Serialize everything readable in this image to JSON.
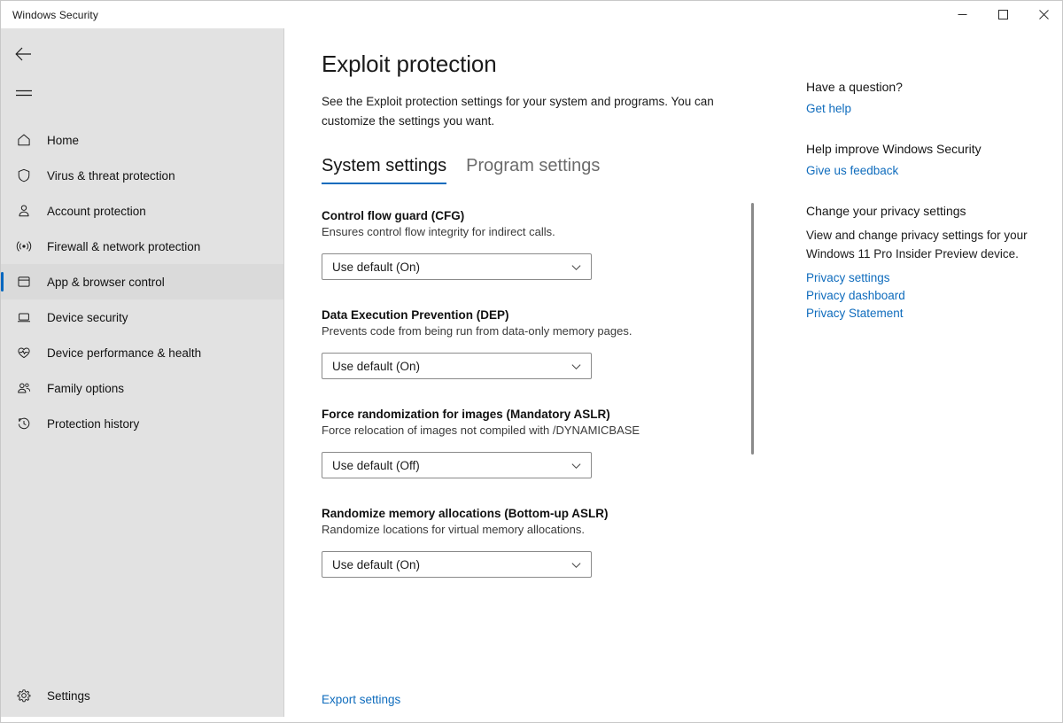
{
  "window": {
    "title": "Windows Security",
    "controls": [
      {
        "name": "minimize",
        "glyph": "minimize-icon"
      },
      {
        "name": "maximize",
        "glyph": "maximize-icon"
      },
      {
        "name": "close",
        "glyph": "close-icon"
      }
    ]
  },
  "sidebar": {
    "back_label": "Back",
    "menu_label": "Menu",
    "items": [
      {
        "label": "Home",
        "icon": "home-icon",
        "selected": false
      },
      {
        "label": "Virus & threat protection",
        "icon": "shield-icon",
        "selected": false
      },
      {
        "label": "Account protection",
        "icon": "person-icon",
        "selected": false
      },
      {
        "label": "Firewall & network protection",
        "icon": "broadcast-icon",
        "selected": false
      },
      {
        "label": "App & browser control",
        "icon": "app-window-icon",
        "selected": true
      },
      {
        "label": "Device security",
        "icon": "laptop-icon",
        "selected": false
      },
      {
        "label": "Device performance & health",
        "icon": "heart-pulse-icon",
        "selected": false
      },
      {
        "label": "Family options",
        "icon": "people-icon",
        "selected": false
      },
      {
        "label": "Protection history",
        "icon": "history-clock-icon",
        "selected": false
      }
    ],
    "settings": {
      "label": "Settings",
      "icon": "gear-icon"
    }
  },
  "main": {
    "title": "Exploit protection",
    "description": "See the Exploit protection settings for your system and programs.  You can customize the settings you want.",
    "tabs": [
      {
        "label": "System settings",
        "active": true
      },
      {
        "label": "Program settings",
        "active": false
      }
    ],
    "settings_sections": [
      {
        "title": "Control flow guard (CFG)",
        "description": "Ensures control flow integrity for indirect calls.",
        "value": "Use default (On)"
      },
      {
        "title": "Data Execution Prevention (DEP)",
        "description": "Prevents code from being run from data-only memory pages.",
        "value": "Use default (On)"
      },
      {
        "title": "Force randomization for images (Mandatory ASLR)",
        "description": "Force relocation of images not compiled with /DYNAMICBASE",
        "value": "Use default (Off)"
      },
      {
        "title": "Randomize memory allocations (Bottom-up ASLR)",
        "description": "Randomize locations for virtual memory allocations.",
        "value": "Use default (On)"
      }
    ],
    "export_link": "Export settings"
  },
  "right_panel": {
    "blocks": [
      {
        "heading": "Have a question?",
        "text": "",
        "links": [
          "Get help"
        ]
      },
      {
        "heading": "Help improve Windows Security",
        "text": "",
        "links": [
          "Give us feedback"
        ]
      },
      {
        "heading": "Change your privacy settings",
        "text": "View and change privacy settings for your Windows 11 Pro Insider Preview device.",
        "links": [
          "Privacy settings",
          "Privacy dashboard",
          "Privacy Statement"
        ]
      }
    ]
  },
  "colors": {
    "accent": "#0067c0",
    "link": "#0f6cbd",
    "sidebar_bg": "#e2e2e2",
    "content_bg": "#ffffff"
  }
}
